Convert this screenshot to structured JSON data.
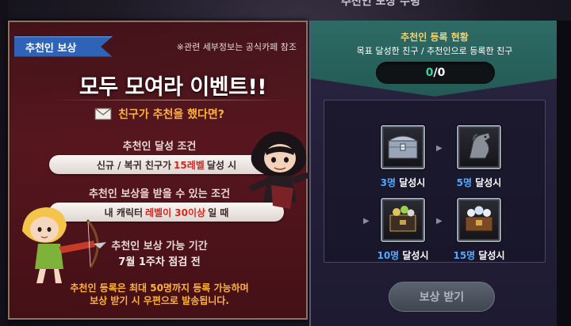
{
  "top_title": "추천인 보상 수령",
  "left_panel": {
    "ribbon": "추천인 보상",
    "ref_note": "※관련 세부정보는 공식카페 참조",
    "event_title": "모두 모여라 이벤트!!",
    "mail_text": "친구가 추천을 했다면?",
    "cond1_label": "추천인 달성 조건",
    "cond1_pre": "신규 / 복귀 친구가",
    "cond1_hl": "15레벨",
    "cond1_post": "달성 시",
    "cond2_label": "추천인 보상을 받을 수 있는 조건",
    "cond2_pre": "내 캐릭터",
    "cond2_hl": "레벨이 30이상",
    "cond2_post": "일 때",
    "period_label": "추천인 보상 가능 기간",
    "period_date": "7월 1주차 점검 전",
    "note_line1": "추천인 등록은 최대 50명까지 등록 가능하며",
    "note_line2": "보상 받기 시 우편으로 발송됩니다."
  },
  "right_panel": {
    "title": "추천인 등록 현황",
    "subtitle": "목표 달성한 친구 / 추천인으로 등록한 친구",
    "count_current": "0",
    "count_sep": " / ",
    "count_total": "0",
    "rewards": [
      {
        "num": "3명",
        "suffix": " 달성시",
        "icon": "silver-chest-icon"
      },
      {
        "num": "5명",
        "suffix": " 달성시",
        "icon": "horse-mount-icon"
      },
      {
        "num": "10명",
        "suffix": " 달성시",
        "icon": "jewel-box-icon"
      },
      {
        "num": "15명",
        "suffix": " 달성시",
        "icon": "treasure-chest-icon"
      }
    ],
    "claim_label": "보상 받기"
  },
  "colors": {
    "accent_orange": "#ffb23a",
    "highlight_red": "#d6261e",
    "count_green": "#39d49b",
    "number_blue": "#4ea9ff",
    "header_teal": "#2f6b66"
  }
}
